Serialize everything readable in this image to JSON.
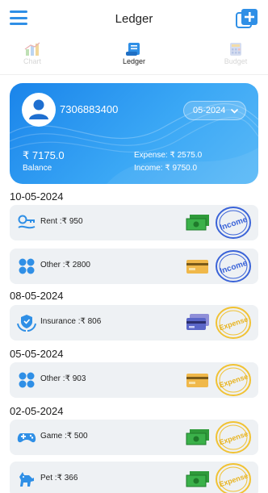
{
  "header": {
    "title": "Ledger",
    "menu_icon": "hamburger-menu-icon",
    "add_icon": "add-square-icon"
  },
  "tabs": [
    {
      "label": "Chart",
      "icon": "bar-chart-icon",
      "active": false
    },
    {
      "label": "Ledger",
      "icon": "ledger-scroll-icon",
      "active": true
    },
    {
      "label": "Budget",
      "icon": "calculator-icon",
      "active": false
    }
  ],
  "summary": {
    "phone": "7306883400",
    "month": "05-2024",
    "balance_amount": "₹ 7175.0",
    "balance_label": "Balance",
    "expense_text": "Expense: ₹ 2575.0",
    "income_text": "Income: ₹ 9750.0"
  },
  "groups": [
    {
      "date": "10-05-2024",
      "entries": [
        {
          "text": "Rent :₹ 950",
          "category_icon": "key-icon",
          "payment_icon": "cash-icon",
          "stamp": "Income"
        },
        {
          "text": "Other :₹ 2800",
          "category_icon": "grid-icon",
          "payment_icon": "card-icon",
          "stamp": "Income"
        }
      ]
    },
    {
      "date": "08-05-2024",
      "entries": [
        {
          "text": "Insurance :₹ 806",
          "category_icon": "shield-hands-icon",
          "payment_icon": "credit-card-icon",
          "stamp": "Expense"
        }
      ]
    },
    {
      "date": "05-05-2024",
      "entries": [
        {
          "text": "Other :₹ 903",
          "category_icon": "grid-icon",
          "payment_icon": "card-icon",
          "stamp": "Expense"
        }
      ]
    },
    {
      "date": "02-05-2024",
      "entries": [
        {
          "text": "Game :₹ 500",
          "category_icon": "gamepad-icon",
          "payment_icon": "cash-icon",
          "stamp": "Expense"
        },
        {
          "text": "Pet :₹ 366",
          "category_icon": "dog-icon",
          "payment_icon": "cash-icon",
          "stamp": "Expense"
        }
      ]
    }
  ],
  "colors": {
    "accent": "#2f8fe6",
    "income_stamp": "#3a63d8",
    "expense_stamp": "#f1c233",
    "row_bg": "#eef1f4"
  }
}
